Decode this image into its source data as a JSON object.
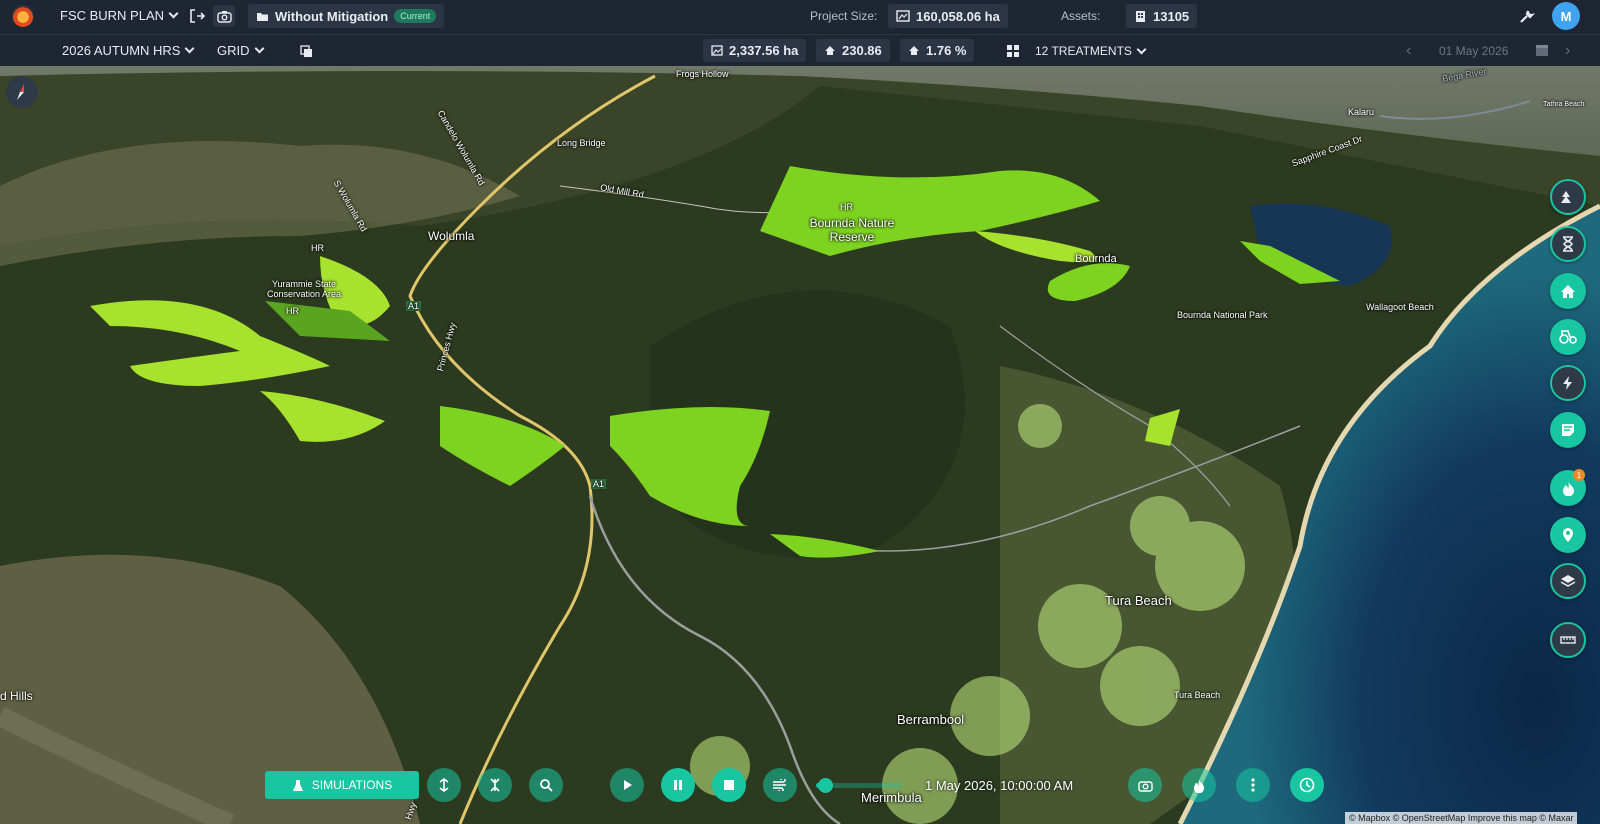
{
  "topbar": {
    "plan_name": "FSC BURN PLAN",
    "scenario_name": "Without Mitigation",
    "scenario_badge": "Current",
    "project_size_label": "Project Size:",
    "project_size_value": "160,058.06 ha",
    "assets_label": "Assets:",
    "assets_value": "13105",
    "avatar_initial": "M"
  },
  "subbar": {
    "season": "2026 AUTUMN HRS",
    "view_mode": "GRID",
    "stat_area": "2,337.56 ha",
    "stat_houses": "230.86",
    "stat_percent": "1.76 %",
    "treatments": "12 TREATMENTS",
    "date": "01 May 2026"
  },
  "map_labels": {
    "frogs_hollow": "Frogs Hollow",
    "long_bridge": "Long Bridge",
    "candelo_rd": "Candelo Wolumla Rd",
    "s_wolumla_rd": "S Wolumla Rd",
    "old_mill_rd": "Old Mill Rd",
    "wolumla": "Wolumla",
    "hr1": "HR",
    "hr2": "HR",
    "hr3": "HR",
    "yurammie": "Yurammie State Conservation Area",
    "a1_north": "A1",
    "a1_south": "A1",
    "princes_hwy": "Princes Hwy",
    "bournda_reserve": "Bournda Nature Reserve",
    "bournda": "Bournda",
    "bournda_np": "Bournda National Park",
    "wallagoot": "Wallagoot Beach",
    "kalaru": "Kalaru",
    "sapphire_coast": "Sapphire Coast Dr",
    "bega_river": "Bega River",
    "tathra": "Tathra Beach",
    "tura_beach_town": "Tura Beach",
    "tura_beach": "Tura Beach",
    "berrambool": "Berrambool",
    "merimbula": "Merimbula",
    "hills": "d Hills",
    "hwy": "Hwy"
  },
  "bottom": {
    "simulations_label": "SIMULATIONS",
    "timestamp": "1 May 2026, 10:00:00 AM",
    "progress": 0.1
  },
  "attribution": "© Mapbox © OpenStreetMap Improve this map © Maxar",
  "colors": {
    "accent": "#18c6a1",
    "burn_bright": "#7ed321",
    "burn_lime": "#a6e22e",
    "topbar": "#1e2633"
  }
}
